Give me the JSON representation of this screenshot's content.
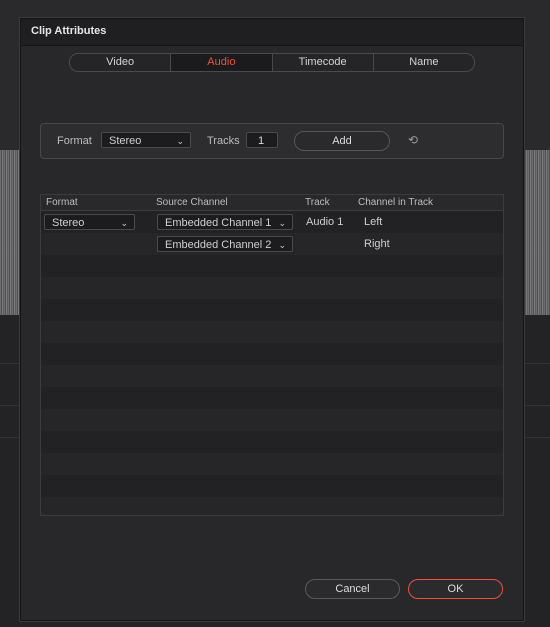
{
  "dialog": {
    "title": "Clip Attributes",
    "tabs": [
      {
        "label": "Video",
        "active": false
      },
      {
        "label": "Audio",
        "active": true
      },
      {
        "label": "Timecode",
        "active": false
      },
      {
        "label": "Name",
        "active": false
      }
    ]
  },
  "format_bar": {
    "format_label": "Format",
    "format_value": "Stereo",
    "tracks_label": "Tracks",
    "tracks_value": "1",
    "add_label": "Add",
    "reset_icon": "reset-icon"
  },
  "table": {
    "headers": [
      "Format",
      "Source Channel",
      "Track",
      "Channel in Track"
    ],
    "rows": [
      {
        "format": "Stereo",
        "source": "Embedded Channel 1",
        "track": "Audio 1",
        "channel": "Left"
      },
      {
        "format": "",
        "source": "Embedded Channel 2",
        "track": "",
        "channel": "Right"
      }
    ]
  },
  "footer": {
    "cancel_label": "Cancel",
    "ok_label": "OK"
  },
  "colors": {
    "accent": "#e8533a",
    "dialog_bg": "#28282b"
  }
}
